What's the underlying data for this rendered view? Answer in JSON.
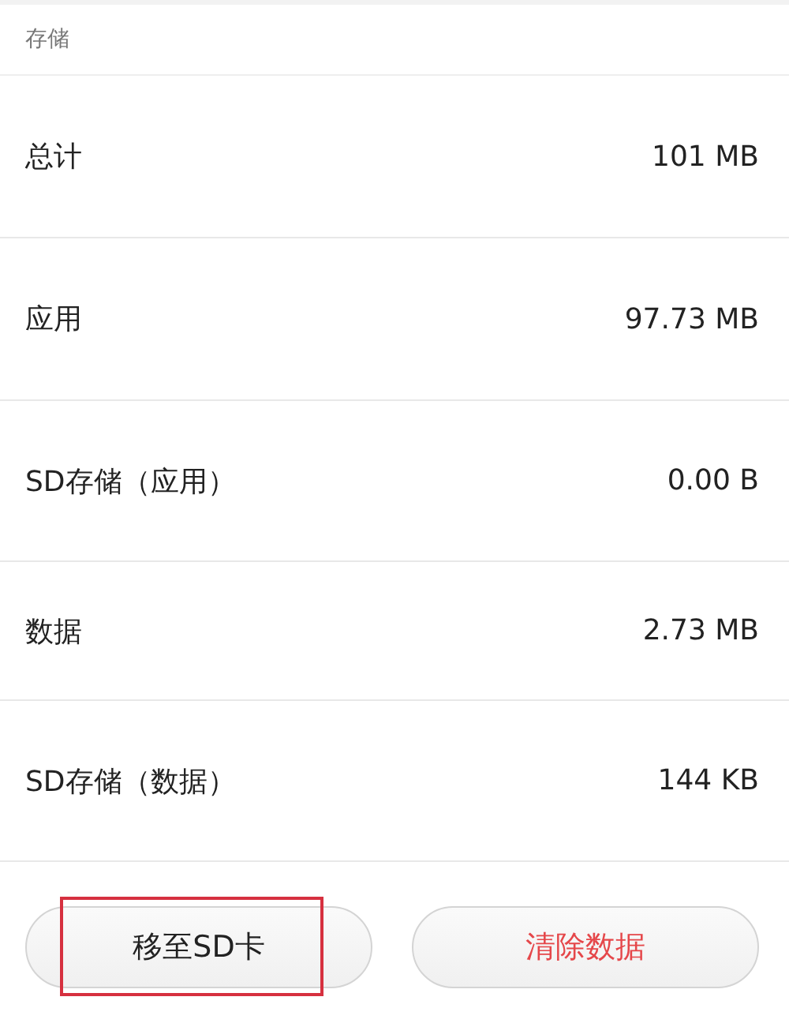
{
  "section": {
    "title": "存储"
  },
  "rows": [
    {
      "label": "总计",
      "value": "101 MB"
    },
    {
      "label": "应用",
      "value": "97.73 MB"
    },
    {
      "label": "SD存储（应用）",
      "value": "0.00 B"
    },
    {
      "label": "数据",
      "value": "2.73 MB"
    },
    {
      "label": "SD存储（数据）",
      "value": "144 KB"
    }
  ],
  "buttons": [
    {
      "label": "移至SD卡",
      "kind": "normal",
      "highlighted": true
    },
    {
      "label": "清除数据",
      "kind": "danger",
      "highlighted": false
    }
  ]
}
